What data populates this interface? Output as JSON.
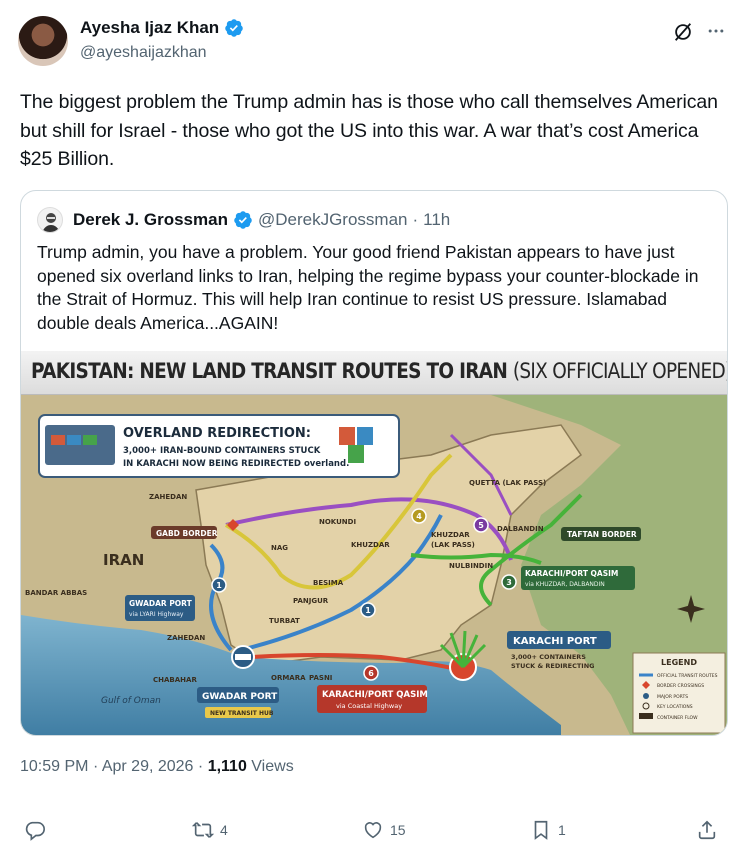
{
  "author": {
    "name": "Ayesha Ijaz Khan",
    "handle": "@ayeshaijazkhan"
  },
  "tweet": {
    "text": "The biggest problem the Trump admin has is those who call themselves American but shill for Israel - those who got the US into this war. A war that’s cost America $25 Billion."
  },
  "quote": {
    "name": "Derek J. Grossman",
    "handle": "@DerekJGrossman",
    "dot": "·",
    "time": "11h",
    "text": "Trump admin, you have a problem. Your good friend Pakistan appears to have just opened six overland links to Iran, helping the regime bypass your counter-blockade in the Strait of Hormuz. This will help Iran continue to resist US pressure. Islamabad double deals America...AGAIN!",
    "map": {
      "title_main": "PAKISTAN: NEW LAND TRANSIT ROUTES TO IRAN",
      "title_sub": "(SIX OFFICIALLY OPENED)",
      "banner_title": "OVERLAND REDIRECTION:",
      "banner_line1": "3,000+ IRAN-BOUND CONTAINERS STUCK",
      "banner_line2": "IN KARACHI NOW BEING REDIRECTED overland.",
      "labels": {
        "iran": "IRAN",
        "zahedan": "ZAHEDAN",
        "gabd": "GABD BORDER",
        "bandar": "BANDAR ABBAS",
        "gwadar_port_side": "GWADAR PORT",
        "gwadar_side_sub": "via LYARI Highway",
        "zahedan2": "ZAHEDAN",
        "chabahar": "CHABAHAR",
        "gulf": "Gulf of Oman",
        "gwadar_port": "GWADAR PORT",
        "gwadar_sub": "NEW TRANSIT HUB",
        "karachi_qasim_bottom": "KARACHI/PORT QASIM",
        "karachi_qasim_bottom_sub": "via Coastal Highway",
        "ormara": "ORMARA",
        "pasni": "PASNI",
        "turbat": "TURBAT",
        "panjgur": "PANJGUR",
        "besima": "BESIMA",
        "nag": "NAG",
        "nokundi": "NOKUNDI",
        "khuzdar": "KHUZDAR",
        "khuzdar_lak": "KHUZDAR",
        "lak_pass": "(LAK PASS)",
        "quetta": "QUETTA (LAK PASS)",
        "dalbandin": "DALBANDIN",
        "taftan": "TAFTAN BORDER",
        "nulbindin": "NULBINDIN",
        "karachi_qasim_right": "KARACHI/PORT QASIM",
        "karachi_qasim_right_sub": "via KHUZDAR, DALBANDIN",
        "karachi_port": "KARACHI PORT",
        "karachi_port_sub1": "3,000+ CONTAINERS",
        "karachi_port_sub2": "STUCK & REDIRECTING"
      },
      "route_numbers": [
        "1",
        "1",
        "3",
        "4",
        "5",
        "6"
      ],
      "legend": {
        "title": "LEGEND",
        "items": [
          "OFFICIAL TRANSIT ROUTES",
          "BORDER CROSSINGS",
          "MAJOR PORTS",
          "KEY LOCATIONS",
          "CONTAINER FLOW"
        ]
      }
    }
  },
  "meta": {
    "time": "10:59 PM",
    "sep1": "·",
    "date": "Apr 29, 2026",
    "sep2": "·",
    "views": "1,110",
    "views_label": "Views"
  },
  "actions": {
    "replies": "",
    "reposts": "4",
    "likes": "15",
    "bookmarks": "1"
  },
  "colors": {
    "verified": "#1d9bf0",
    "text_secondary": "#536471",
    "route_blue": "#3a83c9",
    "route_yellow": "#d8c63a",
    "route_purple": "#9a4fc2",
    "route_green": "#46b33a",
    "route_red": "#d8462d"
  }
}
